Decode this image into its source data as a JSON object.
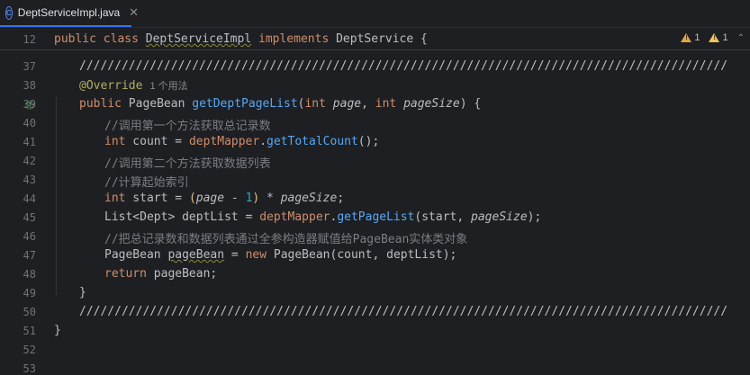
{
  "tab": {
    "label": "DeptServiceImpl.java",
    "icon": "class-icon",
    "icon_letter": "C"
  },
  "sticky": {
    "line": "12",
    "kw_public": "public",
    "kw_class": "class",
    "class_name": "DeptServiceImpl",
    "kw_implements": "implements",
    "interface_name": "DeptService",
    "brace": "{"
  },
  "inspections": {
    "warnings": "1",
    "weak_warnings": "1"
  },
  "lines": {
    "l37": {
      "num": "37",
      "text": "////////////////////////////////////////////////////////////////////////////////////////////"
    },
    "l38": {
      "num": "38",
      "annotation": "@Override",
      "hint": "1 个用法"
    },
    "l39": {
      "num": "39",
      "kw": "public",
      "type": "PageBean",
      "method": "getDeptPageList",
      "p_open": "(",
      "kw_int1": "int",
      "param1": "page",
      "comma": ", ",
      "kw_int2": "int",
      "param2": "pageSize",
      "p_close": ") {"
    },
    "l40": {
      "num": "40",
      "comment": "//调用第一个方法获取总记录数"
    },
    "l41": {
      "num": "41",
      "kw": "int",
      "rest": " count = ",
      "field": "deptMapper",
      "dot": ".",
      "call": "getTotalCount",
      "end": "();"
    },
    "l42": {
      "num": "42",
      "comment": "//调用第二个方法获取数据列表"
    },
    "l43": {
      "num": "43",
      "comment": "//计算起始索引"
    },
    "l44": {
      "num": "44",
      "kw": "int",
      "rest1": " start = ",
      "open": "(",
      "param": "page",
      "minus": " - ",
      "one": "1",
      "close": ")",
      "times": " * ",
      "param2": "pageSize",
      "semi": ";"
    },
    "l45": {
      "num": "45",
      "type": "List<Dept>",
      "rest": " deptList = ",
      "field": "deptMapper",
      "dot": ".",
      "call": "getPageList",
      "args1": "(start, ",
      "param": "pageSize",
      "end": ");"
    },
    "l46": {
      "num": "46",
      "comment": "//把总记录数和数据列表通过全参构造器赋值给PageBean实体类对象"
    },
    "l47": {
      "num": "47",
      "type": "PageBean",
      "sp": " ",
      "var": "pageBean",
      "eq": " = ",
      "kw_new": "new",
      "sp2": " ",
      "type2": "PageBean",
      "args": "(count, deptList);"
    },
    "l48": {
      "num": "48",
      "kw": "return",
      "rest": " pageBean;"
    },
    "l49": {
      "num": "49",
      "text": "}"
    },
    "l50": {
      "num": "50",
      "text": "////////////////////////////////////////////////////////////////////////////////////////////"
    },
    "l51": {
      "num": "51",
      "text": "}"
    },
    "l52": {
      "num": "52"
    },
    "l53": {
      "num": "53"
    }
  }
}
